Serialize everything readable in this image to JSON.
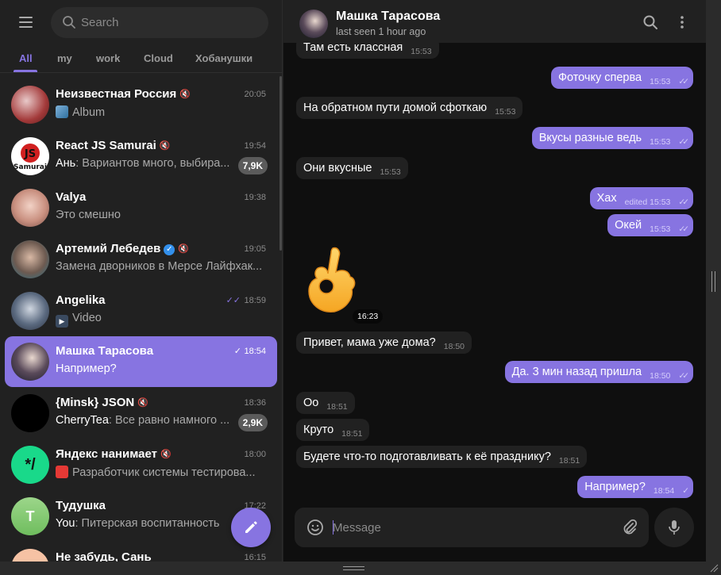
{
  "colors": {
    "accent": "#8774e1",
    "bg": "#0f0f0f",
    "panel": "#212121"
  },
  "search": {
    "placeholder": "Search"
  },
  "tabs": [
    {
      "label": "All"
    },
    {
      "label": "my"
    },
    {
      "label": "work"
    },
    {
      "label": "Cloud"
    },
    {
      "label": "Хобанушки"
    }
  ],
  "chats": [
    {
      "title": "Неизвестная Россия",
      "muted": true,
      "time": "20:05",
      "preview": "Album",
      "preview_icon": "photo-thumbnail"
    },
    {
      "title": "React JS Samurai",
      "muted": true,
      "time": "19:54",
      "sender": "Ань",
      "preview": "Вариантов много, выбира...",
      "badge": "7,9K"
    },
    {
      "title": "Valya",
      "time": "19:38",
      "preview": "Это смешно"
    },
    {
      "title": "Артемий Лебедев",
      "verified": true,
      "muted": true,
      "time": "19:05",
      "preview": "Замена дворников в Мерсе Лайфхак..."
    },
    {
      "title": "Angelika",
      "time": "18:59",
      "read": "double-check",
      "preview": "Video",
      "preview_icon": "video-thumbnail"
    },
    {
      "title": "Машка Тарасова",
      "time": "18:54",
      "read": "check",
      "preview": "Например?",
      "selected": true
    },
    {
      "title": "{Minsk} JSON",
      "muted": true,
      "time": "18:36",
      "sender": "CherryTea",
      "preview": "Все равно намного ...",
      "badge": "2,9K"
    },
    {
      "title": "Яндекс нанимает",
      "muted": true,
      "time": "18:00",
      "preview": "Разработчик системы тестирова...",
      "preview_icon": "red-thumbnail"
    },
    {
      "title": "Тудушка",
      "avatar_letter": "T",
      "time": "17:22",
      "sender": "You",
      "preview": "Питерская воспитанность"
    },
    {
      "title": "Не забудь, Сань",
      "time": "16:15",
      "preview": ""
    }
  ],
  "header": {
    "name": "Машка Тарасова",
    "status": "last seen 1 hour ago"
  },
  "messages": [
    {
      "dir": "in",
      "text": "Там есть классная",
      "time": "15:53"
    },
    {
      "dir": "out",
      "text": "Фоточку сперва",
      "time": "15:53"
    },
    {
      "dir": "in",
      "text": "На обратном пути домой сфоткаю",
      "time": "15:53"
    },
    {
      "dir": "out",
      "text": "Вкусы разные ведь",
      "time": "15:53"
    },
    {
      "dir": "in",
      "text": "Они вкусные",
      "time": "15:53"
    },
    {
      "dir": "out",
      "text": "Хах",
      "edited": "edited",
      "time": "15:53"
    },
    {
      "dir": "out",
      "text": "Окей",
      "time": "15:53"
    },
    {
      "dir": "in",
      "sticker": "ok-hand-sticker",
      "time": "16:23"
    },
    {
      "dir": "in",
      "text": "Привет, мама уже дома?",
      "time": "18:50"
    },
    {
      "dir": "out",
      "text": "Да. 3 мин назад пришла",
      "time": "18:50"
    },
    {
      "dir": "in",
      "text": "Оо",
      "time": "18:51"
    },
    {
      "dir": "in",
      "text": "Круто",
      "time": "18:51"
    },
    {
      "dir": "in",
      "text": "Будете что-то подготавливать к её празднику?",
      "time": "18:51"
    },
    {
      "dir": "out",
      "text": "Например?",
      "time": "18:54"
    }
  ],
  "composer": {
    "placeholder": "Message"
  }
}
